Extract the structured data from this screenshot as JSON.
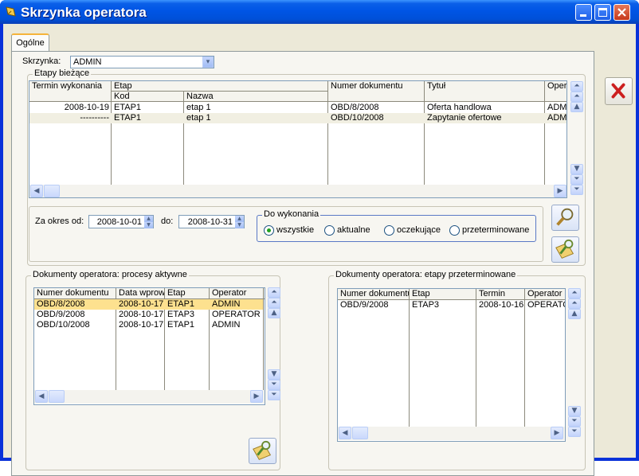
{
  "window": {
    "title": "Skrzynka operatora"
  },
  "tabs": [
    {
      "label": "Ogólne"
    }
  ],
  "skrzynka": {
    "label": "Skrzynka:",
    "value": "ADMIN"
  },
  "etapy_biezace": {
    "legend": "Etapy bieżące",
    "headers": {
      "termin": "Termin wykonania",
      "etap": "Etap",
      "kod": "Kod",
      "nazwa": "Nazwa",
      "numer": "Numer dokumentu",
      "tytul": "Tytuł",
      "operator": "Operator"
    },
    "rows": [
      {
        "termin": "2008-10-19",
        "kod": "ETAP1",
        "nazwa": "etap 1",
        "numer": "OBD/8/2008",
        "tytul": "Oferta handlowa",
        "operator": "ADMIN"
      },
      {
        "termin": "----------",
        "kod": "ETAP1",
        "nazwa": "etap 1",
        "numer": "OBD/10/2008",
        "tytul": "Zapytanie ofertowe",
        "operator": "ADMIN"
      }
    ]
  },
  "filter": {
    "od_label": "Za okres od:",
    "od_value": "2008-10-01",
    "do_label": "do:",
    "do_value": "2008-10-31",
    "group_label": "Do wykonania",
    "options": [
      {
        "label": "wszystkie",
        "selected": true
      },
      {
        "label": "aktualne",
        "selected": false
      },
      {
        "label": "oczekujące",
        "selected": false
      },
      {
        "label": "przeterminowane",
        "selected": false
      }
    ]
  },
  "procesy_aktywne": {
    "legend": "Dokumenty operatora: procesy aktywne",
    "headers": [
      "Numer dokumentu",
      "Data wprowadzenia",
      "Etap",
      "Operator"
    ],
    "rows": [
      {
        "numer": "OBD/8/2008",
        "data": "2008-10-17",
        "etap": "ETAP1",
        "operator": "ADMIN"
      },
      {
        "numer": "OBD/9/2008",
        "data": "2008-10-17",
        "etap": "ETAP3",
        "operator": "OPERATOR"
      },
      {
        "numer": "OBD/10/2008",
        "data": "2008-10-17",
        "etap": "ETAP1",
        "operator": "ADMIN"
      }
    ]
  },
  "etapy_przeterminowane": {
    "legend": "Dokumenty operatora: etapy przeterminowane",
    "headers": [
      "Numer dokumentu",
      "Etap",
      "Termin",
      "Operator"
    ],
    "rows": [
      {
        "numer": "OBD/9/2008",
        "etap": "ETAP3",
        "termin": "2008-10-16",
        "operator": "OPERATOR"
      }
    ]
  },
  "colors": {
    "accent": "#0055e5",
    "selection": "#fde18f",
    "close": "#cc1f1f"
  }
}
